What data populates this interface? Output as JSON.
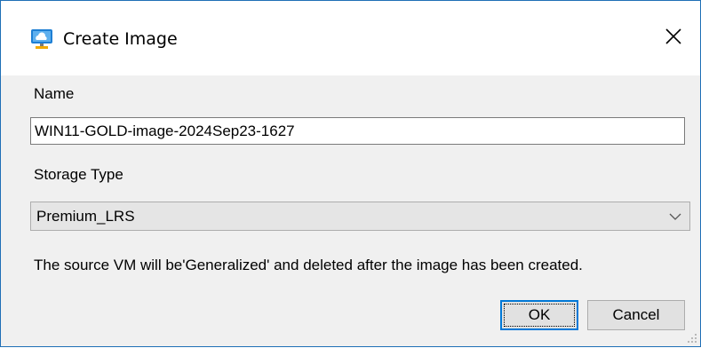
{
  "window": {
    "title": "Create Image",
    "icon": "azure-cloud-monitor-icon",
    "close_icon": "close-icon"
  },
  "form": {
    "name_label": "Name",
    "name_value": "WIN11-GOLD-image-2024Sep23-1627",
    "storage_label": "Storage Type",
    "storage_value": "Premium_LRS",
    "message": "The source VM will be'Generalized' and deleted after the image has been created."
  },
  "buttons": {
    "ok_label": "OK",
    "cancel_label": "Cancel"
  },
  "colors": {
    "window_border": "#1f6fb6",
    "client_background": "#f0f0f0",
    "default_button_border": "#0078d7"
  }
}
